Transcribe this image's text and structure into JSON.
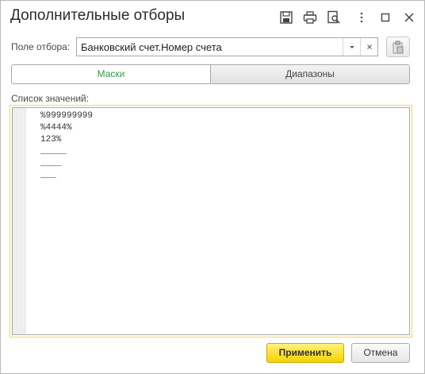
{
  "window": {
    "title": "Дополнительные отборы",
    "toolbar_icons": [
      "save-icon",
      "print-icon",
      "preview-icon",
      "more-icon",
      "maximize-icon",
      "close-icon"
    ]
  },
  "filter": {
    "label": "Поле отбора:",
    "value": "Банковский счет.Номер счета"
  },
  "tabs": [
    {
      "label": "Маски",
      "active": true
    },
    {
      "label": "Диапазоны",
      "active": false
    }
  ],
  "values_list": {
    "label": "Список значений:",
    "lines": [
      "%999999999",
      "%4444%",
      "123%",
      "_____",
      "____",
      "___"
    ]
  },
  "buttons": {
    "apply": "Применить",
    "cancel": "Отмена"
  },
  "colors": {
    "active_tab": "#2f9c45",
    "apply_button": "#f4d300",
    "focus_border": "#f2d56a"
  }
}
